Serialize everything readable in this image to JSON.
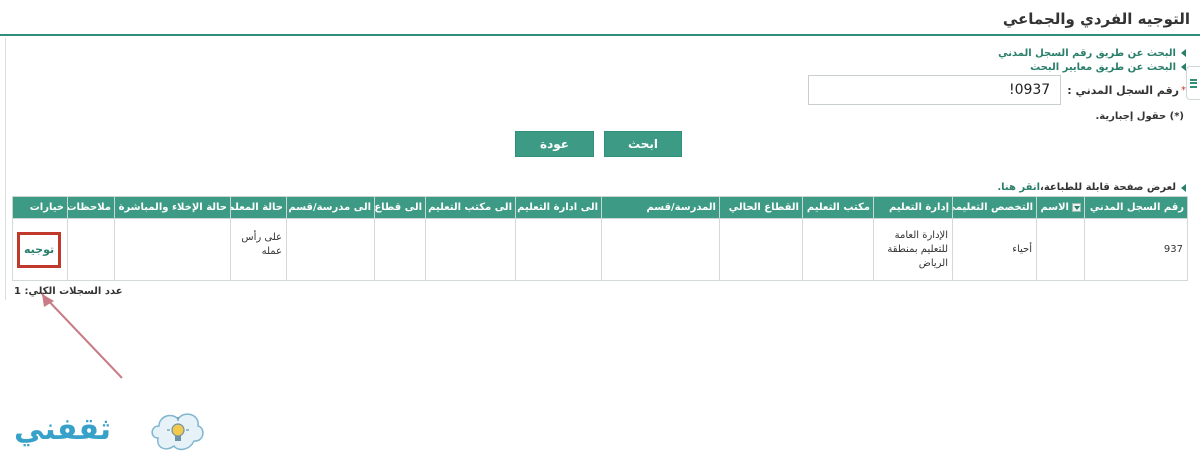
{
  "header": {
    "title": "التوجيه الفردي والجماعي"
  },
  "search_options": [
    {
      "label": "البحث عن طريق رقم السجل المدني"
    },
    {
      "label": "البحث عن طريق معايير البحث"
    }
  ],
  "form": {
    "required_mark": "*",
    "civil_id_label": "رقم السجل المدني :",
    "civil_id_value": "!0937",
    "mandatory_note": "(*) حقول إجبارية."
  },
  "buttons": {
    "search": "ابحث",
    "back": "عودة"
  },
  "print": {
    "text": "لعرض صفحة قابلة للطباعة،",
    "link": "انقر هنا."
  },
  "table": {
    "columns": [
      "رقم السجل المدني",
      "الاسم",
      "التخصص التعليمي",
      "إدارة التعليم",
      "مكتب التعليم",
      "القطاع الحالي",
      "المدرسة/قسم",
      "الى ادارة التعليم",
      "الى مكتب التعليم",
      "الى قطاع",
      "الى مدرسة/قسم",
      "حالة المعلم",
      "حالة الإخلاء والمباشرة",
      "ملاحظات",
      "خيارات"
    ],
    "rows": [
      {
        "civil_id": "937",
        "name": "",
        "specialty": "أحياء",
        "edu_admin": "الإدارة العامة للتعليم بمنطقة الرياض",
        "edu_office": "",
        "current_sector": "",
        "school": "",
        "to_admin": "",
        "to_office": "",
        "to_sector": "",
        "to_school": "",
        "teacher_status": "على رأس عمله",
        "evac_status": "",
        "notes": "",
        "action": "توجيه"
      }
    ]
  },
  "records_total": "عدد السجلات الكلي: 1",
  "watermark": {
    "text": "ثقفني"
  },
  "colors": {
    "accent": "#3c9a85",
    "link": "#2a7f6b",
    "highlight": "#c0392b",
    "logo": "#38a1c9"
  }
}
